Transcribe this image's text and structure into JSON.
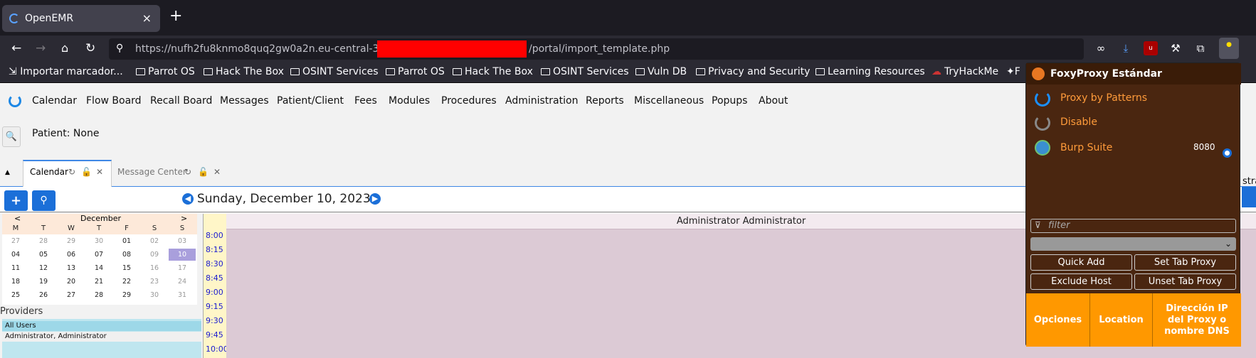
{
  "browser": {
    "tab_title": "OpenEMR",
    "tab_close": "×",
    "new_tab": "+",
    "url_prefix": "https://nufh2fu8knmo8quq2gw0a2n.eu-central-3",
    "url_suffix": "/portal/import_template.php",
    "bookmarks": [
      "Importar marcador...",
      "Parrot OS",
      "Hack The Box",
      "OSINT Services",
      "Parrot OS",
      "Hack The Box",
      "OSINT Services",
      "Vuln DB",
      "Privacy and Security",
      "Learning Resources",
      "TryHackMe",
      "F"
    ]
  },
  "app": {
    "menu": [
      "Calendar",
      "Flow Board",
      "Recall Board",
      "Messages",
      "Patient/Client",
      "Fees",
      "Modules",
      "Procedures",
      "Administration",
      "Reports",
      "Miscellaneous",
      "Popups",
      "About"
    ],
    "patient": "Patient: None",
    "tabs": [
      "Calendar",
      "Message Center"
    ],
    "date": "Sunday, December 10, 2023",
    "add_btn": "+",
    "minical": {
      "prev": "<",
      "month": "December",
      "next": ">",
      "dows": [
        "M",
        "T",
        "W",
        "T",
        "F",
        "S",
        "S"
      ],
      "weeks": [
        [
          "27",
          "28",
          "29",
          "30",
          "01",
          "02",
          "03"
        ],
        [
          "04",
          "05",
          "06",
          "07",
          "08",
          "09",
          "10"
        ],
        [
          "11",
          "12",
          "13",
          "14",
          "15",
          "16",
          "17"
        ],
        [
          "18",
          "19",
          "20",
          "21",
          "22",
          "23",
          "24"
        ],
        [
          "25",
          "26",
          "27",
          "28",
          "29",
          "30",
          "31"
        ]
      ]
    },
    "providers_label": "Providers",
    "providers": [
      "All Users",
      "Administrator, Administrator"
    ],
    "times": [
      "8:00",
      "8:15",
      "8:30",
      "8:45",
      "9:00",
      "9:15",
      "9:30",
      "9:45",
      "10:00"
    ],
    "provider_header": "Administrator Administrator",
    "edge_text": "stra"
  },
  "foxy": {
    "title": "FoxyProxy Estándar",
    "options": [
      "Proxy by Patterns",
      "Disable",
      "Burp Suite"
    ],
    "port": "8080",
    "filter_placeholder": "filter",
    "select_arrow": "⌄",
    "buttons": [
      "Quick Add",
      "Set Tab Proxy",
      "Exclude Host",
      "Unset Tab Proxy"
    ],
    "footer": [
      "Opciones",
      "Location",
      "Dirección IP del Proxy o nombre DNS"
    ]
  }
}
